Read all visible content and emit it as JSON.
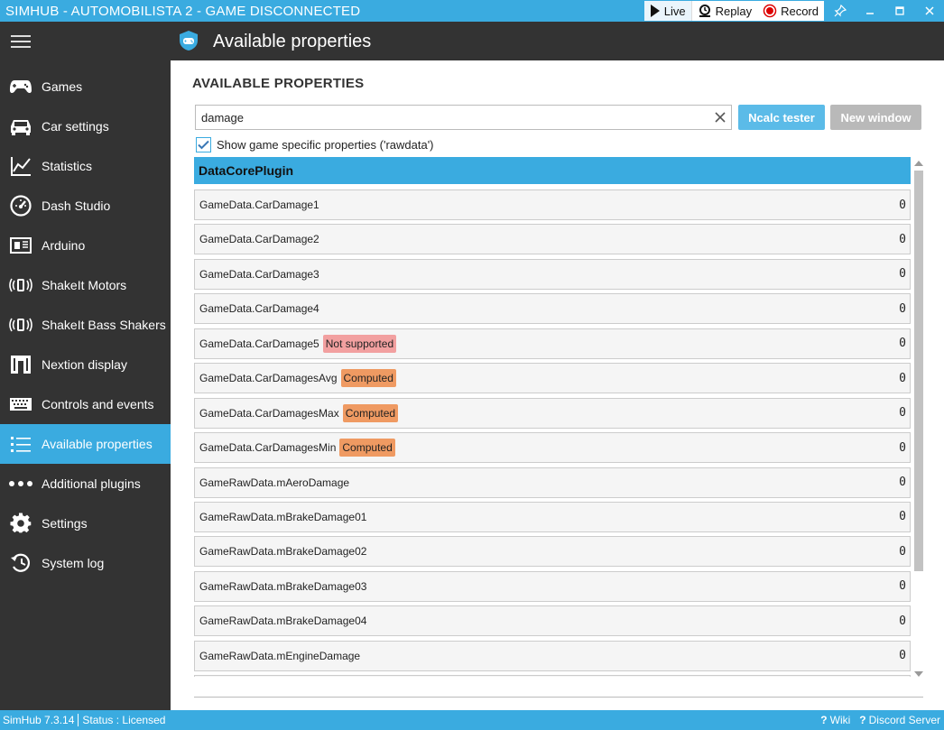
{
  "window": {
    "title": "SIMHUB - AUTOMOBILISTA 2 - GAME DISCONNECTED",
    "modes": [
      {
        "label": "Live",
        "icon": "play-icon"
      },
      {
        "label": "Replay",
        "icon": "replay-icon"
      },
      {
        "label": "Record",
        "icon": "record-icon"
      }
    ],
    "controls": [
      "pin-icon",
      "minimize-icon",
      "maximize-icon",
      "close-icon"
    ]
  },
  "header": {
    "title": "Available properties",
    "icon": "gamepad-shield-icon"
  },
  "sidebar": {
    "items": [
      {
        "label": "Games",
        "icon": "gamepad-icon"
      },
      {
        "label": "Car settings",
        "icon": "car-icon"
      },
      {
        "label": "Statistics",
        "icon": "chart-icon"
      },
      {
        "label": "Dash Studio",
        "icon": "gauge-icon"
      },
      {
        "label": "Arduino",
        "icon": "arduino-icon"
      },
      {
        "label": "ShakeIt Motors",
        "icon": "vibration-icon"
      },
      {
        "label": "ShakeIt Bass Shakers",
        "icon": "vibration-icon"
      },
      {
        "label": "Nextion display",
        "icon": "nextion-icon"
      },
      {
        "label": "Controls and events",
        "icon": "keyboard-icon"
      },
      {
        "label": "Available properties",
        "icon": "list-icon",
        "active": true
      },
      {
        "label": "Additional plugins",
        "icon": "dots-icon"
      },
      {
        "label": "Settings",
        "icon": "gear-icon"
      },
      {
        "label": "System log",
        "icon": "history-icon"
      }
    ]
  },
  "main": {
    "section_title": "AVAILABLE PROPERTIES",
    "search": {
      "value": "damage",
      "placeholder": ""
    },
    "ncalc_label": "Ncalc tester",
    "new_window_label": "New window",
    "checkbox_label": "Show game specific properties ('rawdata')",
    "checkbox_checked": true,
    "group": "DataCorePlugin",
    "rows": [
      {
        "name": "GameData.CarDamage1",
        "badge": "",
        "value": "0"
      },
      {
        "name": "GameData.CarDamage2",
        "badge": "",
        "value": "0"
      },
      {
        "name": "GameData.CarDamage3",
        "badge": "",
        "value": "0"
      },
      {
        "name": "GameData.CarDamage4",
        "badge": "",
        "value": "0"
      },
      {
        "name": "GameData.CarDamage5",
        "badge": "Not supported",
        "badge_type": "notsup",
        "value": "0"
      },
      {
        "name": "GameData.CarDamagesAvg",
        "badge": "Computed",
        "badge_type": "computed",
        "value": "0"
      },
      {
        "name": "GameData.CarDamagesMax",
        "badge": "Computed",
        "badge_type": "computed",
        "value": "0"
      },
      {
        "name": "GameData.CarDamagesMin",
        "badge": "Computed",
        "badge_type": "computed",
        "value": "0"
      },
      {
        "name": "GameRawData.mAeroDamage",
        "badge": "",
        "value": "0"
      },
      {
        "name": "GameRawData.mBrakeDamage01",
        "badge": "",
        "value": "0"
      },
      {
        "name": "GameRawData.mBrakeDamage02",
        "badge": "",
        "value": "0"
      },
      {
        "name": "GameRawData.mBrakeDamage03",
        "badge": "",
        "value": "0"
      },
      {
        "name": "GameRawData.mBrakeDamage04",
        "badge": "",
        "value": "0"
      },
      {
        "name": "GameRawData.mEngineDamage",
        "badge": "",
        "value": "0"
      },
      {
        "name": "",
        "badge": "",
        "value": ""
      }
    ]
  },
  "status": {
    "version": "SimHub 7.3.14",
    "status_text": "Status :  Licensed",
    "wiki_label": "Wiki",
    "discord_label": "Discord Server"
  },
  "colors": {
    "accent": "#3aabe0",
    "sidebar_bg": "#333333",
    "not_supported": "#f2a0a0",
    "computed": "#ef9a62"
  }
}
